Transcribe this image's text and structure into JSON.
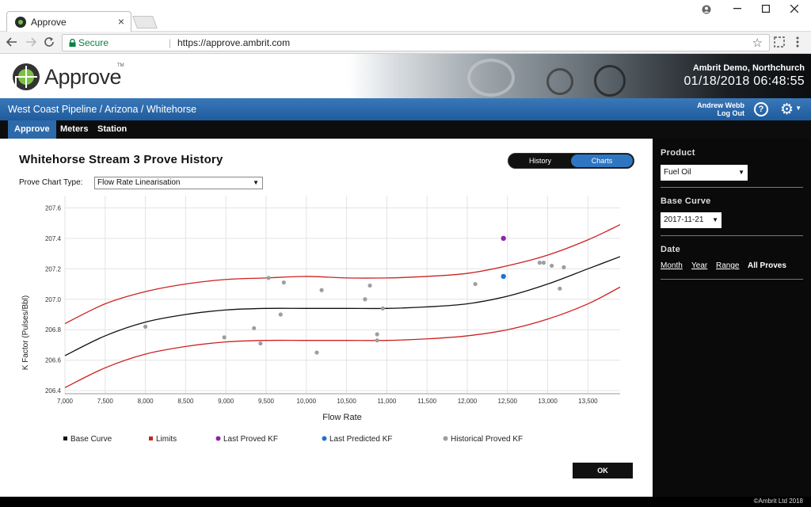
{
  "browser": {
    "tab_title": "Approve",
    "tab_close": "×",
    "window_controls": [
      "minimize-icon",
      "maximize-icon",
      "close-icon"
    ],
    "secure_label": "Secure",
    "url": "https://approve.ambrit.com"
  },
  "header": {
    "logo_text": "Approve",
    "logo_tm": "TM",
    "company": "Ambrit Demo, Northchurch",
    "datetime": "01/18/2018 06:48:55"
  },
  "bluebar": {
    "breadcrumb": "West Coast Pipeline / Arizona / Whitehorse",
    "user_name": "Andrew Webb",
    "logout": "Log Out",
    "help": "?"
  },
  "nav": {
    "tabs": [
      {
        "label": "Approve",
        "active": true
      },
      {
        "label": "Meters",
        "active": false
      },
      {
        "label": "Station",
        "active": false
      }
    ]
  },
  "main": {
    "title": "Whitehorse Stream 3 Prove History",
    "toggle": {
      "history": "History",
      "charts": "Charts",
      "active": "charts"
    },
    "chart_type_label": "Prove Chart Type:",
    "chart_type_value": "Flow Rate Linearisation",
    "ok_label": "OK"
  },
  "sidebar": {
    "product_label": "Product",
    "product_value": "Fuel Oil",
    "base_curve_label": "Base Curve",
    "base_curve_value": "2017-11-21",
    "date_label": "Date",
    "date_links": [
      "Month",
      "Year",
      "Range",
      "All Proves"
    ],
    "date_active": "All Proves"
  },
  "footer": {
    "copyright": "©Ambrit Ltd 2018"
  },
  "colors": {
    "base_curve": "#111111",
    "limits": "#cc2222",
    "last_proved": "#8e24aa",
    "last_predicted": "#1e73c9",
    "historical": "#9e9e9e",
    "accent_blue": "#2f76c2"
  },
  "chart_data": {
    "type": "scatter",
    "xlabel": "Flow Rate",
    "ylabel": "K Factor (Pulses/Bbl)",
    "xlim": [
      7000,
      13900
    ],
    "ylim": [
      206.38,
      207.68
    ],
    "x_ticks": [
      7000,
      7500,
      8000,
      8500,
      9000,
      9500,
      10000,
      10500,
      11000,
      11500,
      12000,
      12500,
      13000,
      13500
    ],
    "x_tick_labels": [
      "7,000",
      "7,500",
      "8,000",
      "8,500",
      "9,000",
      "9,500",
      "10,000",
      "10,500",
      "11,000",
      "11,500",
      "12,000",
      "12,500",
      "13,000",
      "13,500"
    ],
    "y_ticks": [
      206.4,
      206.6,
      206.8,
      207.0,
      207.2,
      207.4,
      207.6
    ],
    "y_tick_labels": [
      "206.4",
      "206.6",
      "206.8",
      "207.0",
      "207.2",
      "207.4",
      "207.6"
    ],
    "grid": true,
    "legend_placement": "bottom",
    "series": [
      {
        "name": "Base Curve",
        "kind": "line",
        "color": "#111111",
        "x": [
          7000,
          7500,
          8000,
          8500,
          9000,
          9500,
          10000,
          10500,
          11000,
          11500,
          12000,
          12500,
          13000,
          13500,
          13900
        ],
        "y": [
          206.63,
          206.76,
          206.85,
          206.9,
          206.93,
          206.94,
          206.94,
          206.94,
          206.94,
          206.95,
          206.97,
          207.02,
          207.1,
          207.2,
          207.28
        ]
      },
      {
        "name": "Limits",
        "kind": "line",
        "color": "#cc2222",
        "x": [
          7000,
          7500,
          8000,
          8500,
          9000,
          9500,
          10000,
          10500,
          11000,
          11500,
          12000,
          12500,
          13000,
          13500,
          13900
        ],
        "y": [
          206.84,
          206.97,
          207.05,
          207.1,
          207.13,
          207.14,
          207.15,
          207.14,
          207.14,
          207.15,
          207.17,
          207.22,
          207.29,
          207.39,
          207.49
        ]
      },
      {
        "name": "",
        "kind": "line",
        "color": "#cc2222",
        "x": [
          7000,
          7500,
          8000,
          8500,
          9000,
          9500,
          10000,
          10500,
          11000,
          11500,
          12000,
          12500,
          13000,
          13500,
          13900
        ],
        "y": [
          206.42,
          206.55,
          206.64,
          206.69,
          206.72,
          206.73,
          206.73,
          206.73,
          206.73,
          206.74,
          206.76,
          206.8,
          206.87,
          206.97,
          207.08
        ]
      },
      {
        "name": "Last Proved KF",
        "kind": "point",
        "color": "#8e24aa",
        "x": [
          12450
        ],
        "y": [
          207.4
        ]
      },
      {
        "name": "Last Predicted KF",
        "kind": "point",
        "color": "#1e73c9",
        "x": [
          12450
        ],
        "y": [
          207.15
        ]
      },
      {
        "name": "Historical Proved KF",
        "kind": "point",
        "color": "#9e9e9e",
        "x": [
          8000,
          8980,
          9350,
          9430,
          9530,
          9680,
          9720,
          10130,
          10190,
          10730,
          10790,
          10880,
          10880,
          10950,
          12100,
          12900,
          12950,
          13050,
          13150,
          13200
        ],
        "y": [
          206.82,
          206.75,
          206.81,
          206.71,
          207.14,
          206.9,
          207.11,
          206.65,
          207.06,
          207.0,
          207.09,
          206.77,
          206.73,
          206.94,
          207.1,
          207.24,
          207.24,
          207.22,
          207.07,
          207.21
        ]
      }
    ]
  }
}
